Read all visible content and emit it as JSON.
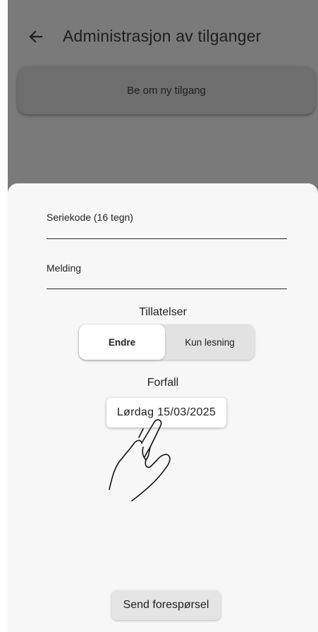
{
  "app_bar": {
    "title": "Administrasjon av tilganger",
    "back_icon": "arrow-left-icon"
  },
  "request_card": {
    "label": "Be om ny tilgang"
  },
  "form": {
    "serial_field": {
      "label": "Seriekode (16 tegn)",
      "value": ""
    },
    "message_field": {
      "label": "Melding",
      "value": ""
    },
    "permissions": {
      "heading": "Tillatelser",
      "options": [
        "Endre",
        "Kun lesning"
      ],
      "selected": "Endre"
    },
    "due": {
      "heading": "Forfall",
      "date_label": "Lørdag 15/03/2025"
    },
    "send_label": "Send forespørsel"
  },
  "gesture": {
    "icon": "tap-hand-icon"
  },
  "colors": {
    "scrim": "#7a7a7a",
    "sheet": "#f7f7f7",
    "toggle_track": "#e2e2e2",
    "selected": "#ffffff"
  }
}
